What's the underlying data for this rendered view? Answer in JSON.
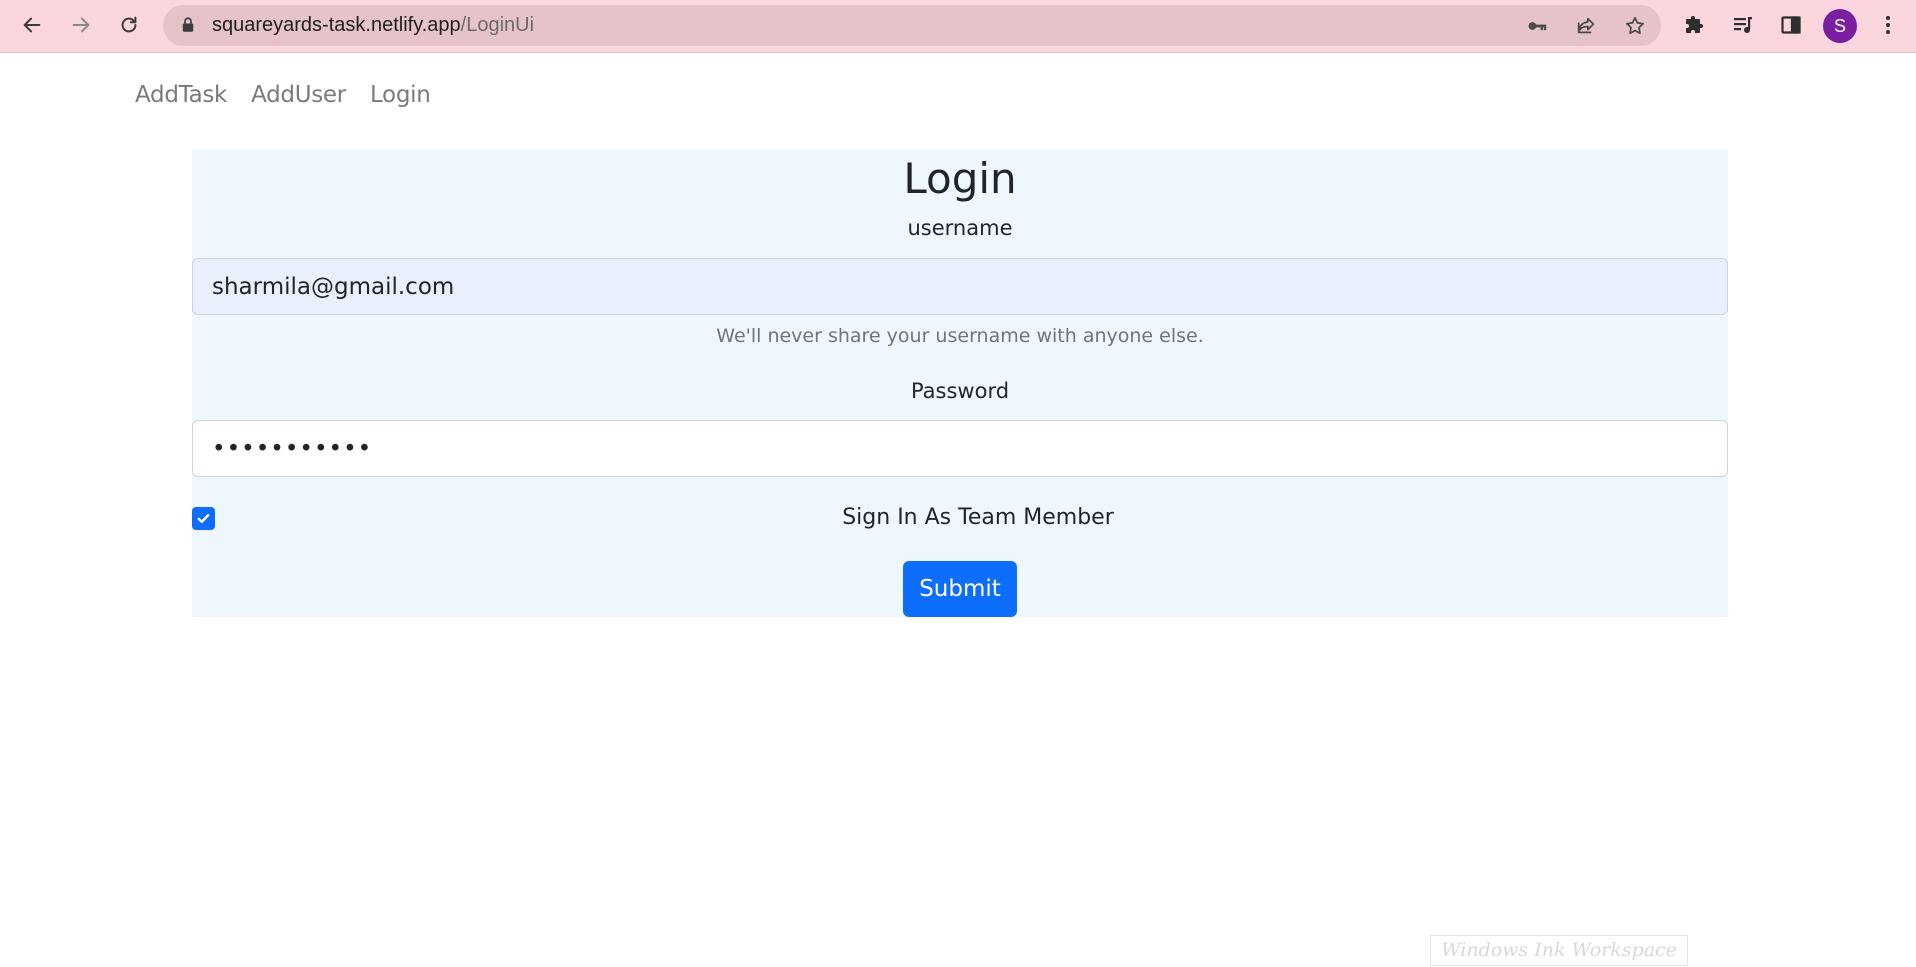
{
  "browser": {
    "url_host": "squareyards-task.netlify.app",
    "url_path": "/LoginUi",
    "profile_initial": "S",
    "avatar_color": "#7a1fa2",
    "chrome_color": "#fcd6df",
    "icons": {
      "back": "arrow-left-icon",
      "forward": "arrow-right-icon",
      "reload": "reload-icon",
      "lock": "lock-icon",
      "key": "key-icon",
      "share": "share-icon",
      "star": "star-icon",
      "extensions": "puzzle-icon",
      "media": "media-control-icon",
      "side_panel": "side-panel-icon",
      "menu": "kebab-menu-icon"
    }
  },
  "nav": {
    "items": [
      "AddTask",
      "AddUser",
      "Login"
    ]
  },
  "login_form": {
    "title": "Login",
    "username_label": "username",
    "username_value": "sharmila@gmail.com",
    "username_help": "We'll never share your username with anyone else.",
    "password_label": "Password",
    "password_value": "sharmila123",
    "checkbox_label": "Sign In As Team Member",
    "checkbox_checked": true,
    "submit_label": "Submit",
    "accent_color": "#0d6efd",
    "card_background": "#eef6fe"
  },
  "overlay": {
    "watermark_text": "Windows Ink Workspace"
  }
}
